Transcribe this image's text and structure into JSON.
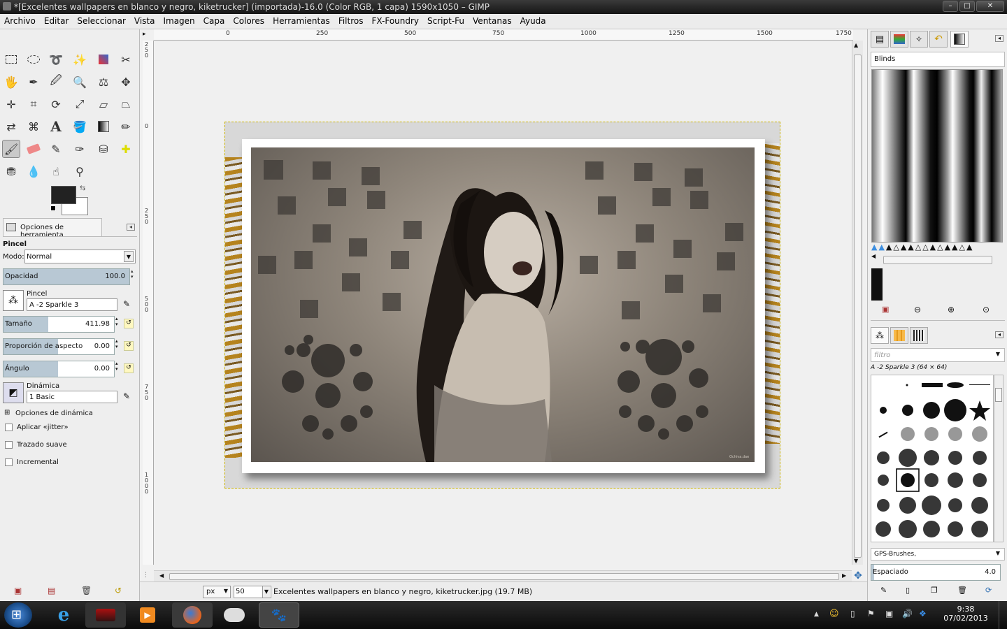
{
  "window": {
    "title": "*[Excelentes wallpapers en blanco y negro, kiketrucker] (importada)-16.0 (Color RGB, 1 capa) 1590x1050 – GIMP"
  },
  "menu": [
    "Archivo",
    "Editar",
    "Seleccionar",
    "Vista",
    "Imagen",
    "Capa",
    "Colores",
    "Herramientas",
    "Filtros",
    "FX-Foundry",
    "Script-Fu",
    "Ventanas",
    "Ayuda"
  ],
  "rulers": {
    "h": [
      "0",
      "250",
      "500",
      "750",
      "1000",
      "1250",
      "1500",
      "1750"
    ],
    "v": [
      "250",
      "0",
      "250",
      "500",
      "750",
      "1000"
    ]
  },
  "tool_options": {
    "tab": "Opciones de herramienta",
    "title": "Pincel",
    "mode_label": "Modo:",
    "mode_value": "Normal",
    "opacity_label": "Opacidad",
    "opacity_value": "100.0",
    "opacity_level": 1.0,
    "brush_label": "Pincel",
    "brush_value": "A -2 Sparkle 3",
    "size_label": "Tamaño",
    "size_value": "411.98",
    "aspect_label": "Proporción de aspecto",
    "aspect_value": "0.00",
    "angle_label": "Ángulo",
    "angle_value": "0.00",
    "dynamics_label": "Dinámica",
    "dynamics_value": "1 Basic",
    "dyn_options": "Opciones de dinámica",
    "jitter": "Aplicar «jitter»",
    "smooth": "Trazado suave",
    "incremental": "Incremental"
  },
  "status": {
    "unit": "px",
    "zoom": "50",
    "message": "Excelentes wallpapers en blanco y negro, kiketrucker.jpg (19.7 MB)"
  },
  "gradients": {
    "name": "Blinds"
  },
  "brushes": {
    "filter_placeholder": "filtro",
    "current": "A -2 Sparkle 3 (64 × 64)",
    "tag": "GPS-Brushes,",
    "spacing_label": "Espaciado",
    "spacing_value": "4.0"
  },
  "clock": {
    "time": "9:38",
    "date": "07/02/2013"
  },
  "image": {
    "watermark": "Ochiva.dae"
  },
  "colors": {
    "accent": "#3c8ee0",
    "fg": "#222222",
    "bg": "#ffffff"
  }
}
